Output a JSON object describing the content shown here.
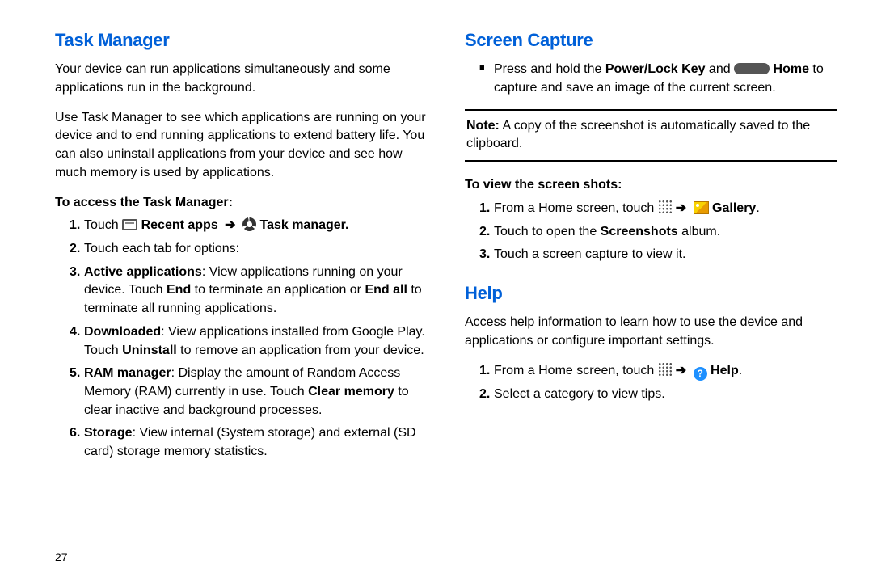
{
  "page_number": "27",
  "left": {
    "heading": "Task Manager",
    "p1": "Your device can run applications simultaneously and some applications run in the background.",
    "p2": "Use Task Manager to see which applications are running on your device and to end running applications to extend battery life. You can also uninstall applications from your device and see how much memory is used by applications.",
    "sub": "To access the Task Manager:",
    "s1_a": "Touch ",
    "s1_b": " Recent apps ",
    "s1_c": " Task manager.",
    "s2": "Touch each tab for options:",
    "s3_label": "Active applications",
    "s3_rest_a": ": View applications running on your device. Touch ",
    "s3_end": "End",
    "s3_rest_b": " to terminate an application or ",
    "s3_endall": "End all",
    "s3_rest_c": " to terminate all running applications.",
    "s4_label": "Downloaded",
    "s4_rest_a": ": View applications installed from Google Play. Touch ",
    "s4_uninstall": "Uninstall",
    "s4_rest_b": " to remove an application from your device.",
    "s5_label": "RAM manager",
    "s5_rest_a": ": Display the amount of Random Access Memory (RAM) currently in use. Touch ",
    "s5_clear": "Clear memory",
    "s5_rest_b": " to clear inactive and background processes.",
    "s6_label": "Storage",
    "s6_rest": ": View internal (System storage) and external (SD card) storage memory statistics."
  },
  "right": {
    "heading1": "Screen Capture",
    "bullet_a": "Press and hold the ",
    "bullet_key": "Power/Lock Key",
    "bullet_b": " and ",
    "bullet_home": " Home",
    "bullet_c": " to capture and save an image of the current screen.",
    "note_label": "Note:",
    "note_body": " A copy of the screenshot is automatically saved to the clipboard.",
    "sub1": "To view the screen shots:",
    "v1_a": "From a Home screen, touch ",
    "v1_gallery": " Gallery",
    "v2_a": "Touch to open the ",
    "v2_b": "Screenshots",
    "v2_c": " album.",
    "v3": "Touch a screen capture to view it.",
    "heading2": "Help",
    "help_p": "Access help information to learn how to use the device and applications or configure important settings.",
    "h1_a": "From a Home screen, touch ",
    "h1_help": " Help",
    "h2": "Select a category to view tips."
  }
}
